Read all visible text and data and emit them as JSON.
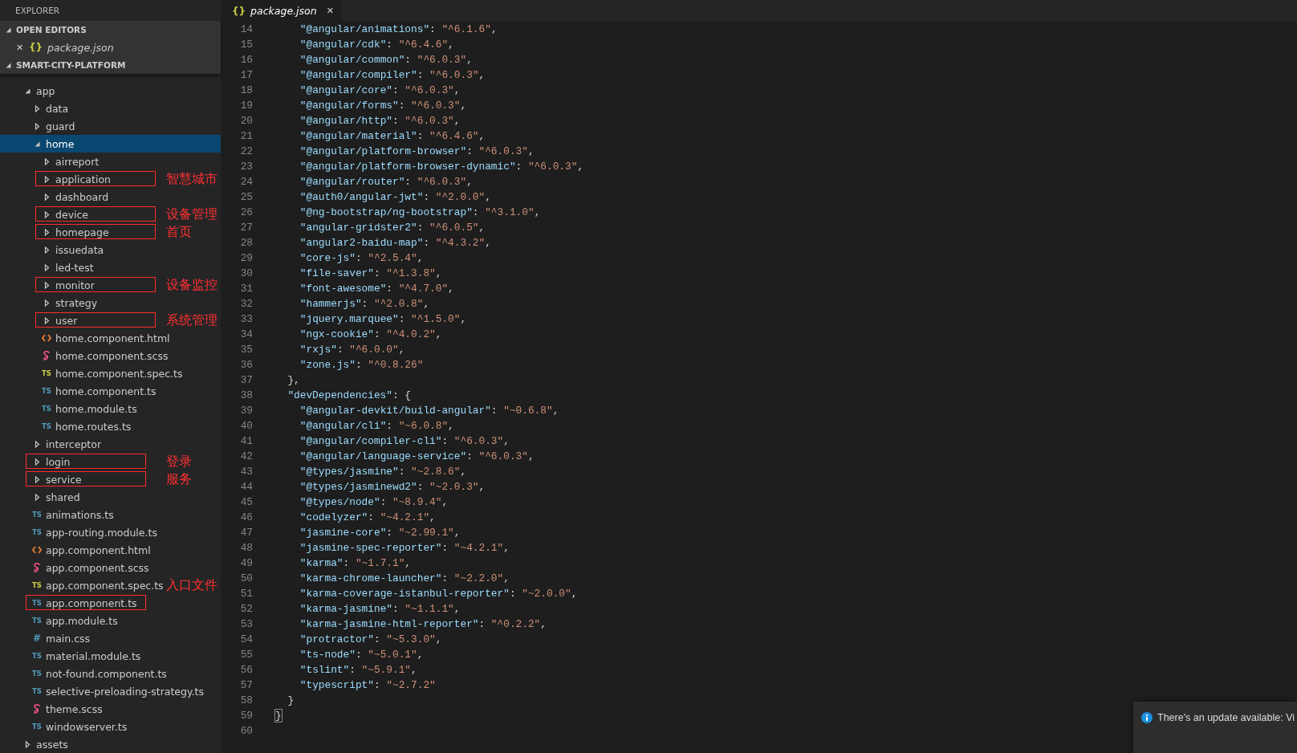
{
  "sidebar": {
    "title": "EXPLORER",
    "open_editors": {
      "label": "OPEN EDITORS",
      "expanded": true,
      "items": [
        {
          "close": "✕",
          "icon_text": "{}",
          "name": "package.json",
          "selected": false
        }
      ]
    },
    "project": {
      "label": "SMART-CITY-PLATFORM",
      "expanded": true
    },
    "tree": [
      {
        "name": "app",
        "kind": "folder",
        "expanded": true,
        "selected": false,
        "annotated": false,
        "children": [
          {
            "name": "data",
            "kind": "folder",
            "expanded": false,
            "selected": false,
            "annotated": false
          },
          {
            "name": "guard",
            "kind": "folder",
            "expanded": false,
            "selected": false,
            "annotated": false
          },
          {
            "name": "home",
            "kind": "folder",
            "expanded": true,
            "selected": true,
            "annotated": false,
            "children": [
              {
                "name": "airreport",
                "kind": "folder",
                "expanded": false,
                "selected": false,
                "annotated": false
              },
              {
                "name": "application",
                "kind": "folder",
                "expanded": false,
                "selected": false,
                "annotated": true,
                "note": "智慧城市"
              },
              {
                "name": "dashboard",
                "kind": "folder",
                "expanded": false,
                "selected": false,
                "annotated": false
              },
              {
                "name": "device",
                "kind": "folder",
                "expanded": false,
                "selected": false,
                "annotated": true,
                "note": "设备管理"
              },
              {
                "name": "homepage",
                "kind": "folder",
                "expanded": false,
                "selected": false,
                "annotated": true,
                "note": "首页"
              },
              {
                "name": "issuedata",
                "kind": "folder",
                "expanded": false,
                "selected": false,
                "annotated": false
              },
              {
                "name": "led-test",
                "kind": "folder",
                "expanded": false,
                "selected": false,
                "annotated": false
              },
              {
                "name": "monitor",
                "kind": "folder",
                "expanded": false,
                "selected": false,
                "annotated": true,
                "note": "设备监控"
              },
              {
                "name": "strategy",
                "kind": "folder",
                "expanded": false,
                "selected": false,
                "annotated": false
              },
              {
                "name": "user",
                "kind": "folder",
                "expanded": false,
                "selected": false,
                "annotated": true,
                "note": "系统管理"
              },
              {
                "name": "home.component.html",
                "kind": "html",
                "selected": false,
                "annotated": false
              },
              {
                "name": "home.component.scss",
                "kind": "scss",
                "selected": false,
                "annotated": false
              },
              {
                "name": "home.component.spec.ts",
                "kind": "spec",
                "badge": "TS",
                "selected": false,
                "annotated": false
              },
              {
                "name": "home.component.ts",
                "kind": "ts",
                "badge": "TS",
                "selected": false,
                "annotated": false
              },
              {
                "name": "home.module.ts",
                "kind": "ts",
                "badge": "TS",
                "selected": false,
                "annotated": false
              },
              {
                "name": "home.routes.ts",
                "kind": "ts",
                "badge": "TS",
                "selected": false,
                "annotated": false
              }
            ]
          },
          {
            "name": "interceptor",
            "kind": "folder",
            "expanded": false,
            "selected": false,
            "annotated": false
          },
          {
            "name": "login",
            "kind": "folder",
            "expanded": false,
            "selected": false,
            "annotated": true,
            "note": "登录"
          },
          {
            "name": "service",
            "kind": "folder",
            "expanded": false,
            "selected": false,
            "annotated": true,
            "note": "服务"
          },
          {
            "name": "shared",
            "kind": "folder",
            "expanded": false,
            "selected": false,
            "annotated": false
          },
          {
            "name": "animations.ts",
            "kind": "ts",
            "badge": "TS",
            "selected": false,
            "annotated": false
          },
          {
            "name": "app-routing.module.ts",
            "kind": "ts",
            "badge": "TS",
            "selected": false,
            "annotated": false
          },
          {
            "name": "app.component.html",
            "kind": "html",
            "selected": false,
            "annotated": false
          },
          {
            "name": "app.component.scss",
            "kind": "scss",
            "selected": false,
            "annotated": false
          },
          {
            "name": "app.component.spec.ts",
            "kind": "spec",
            "badge": "TS",
            "selected": false,
            "annotated": false,
            "note": "入口文件"
          },
          {
            "name": "app.component.ts",
            "kind": "ts",
            "badge": "TS",
            "selected": false,
            "annotated": true
          },
          {
            "name": "app.module.ts",
            "kind": "ts",
            "badge": "TS",
            "selected": false,
            "annotated": false
          },
          {
            "name": "main.css",
            "kind": "css",
            "badge": "#",
            "selected": false,
            "annotated": false
          },
          {
            "name": "material.module.ts",
            "kind": "ts",
            "badge": "TS",
            "selected": false,
            "annotated": false
          },
          {
            "name": "not-found.component.ts",
            "kind": "ts",
            "badge": "TS",
            "selected": false,
            "annotated": false
          },
          {
            "name": "selective-preloading-strategy.ts",
            "kind": "ts",
            "badge": "TS",
            "selected": false,
            "annotated": false
          },
          {
            "name": "theme.scss",
            "kind": "scss",
            "selected": false,
            "annotated": false
          },
          {
            "name": "windowserver.ts",
            "kind": "ts",
            "badge": "TS",
            "selected": false,
            "annotated": false
          }
        ]
      },
      {
        "name": "assets",
        "kind": "folder",
        "expanded": false,
        "selected": false,
        "annotated": false
      }
    ]
  },
  "tabs": [
    {
      "icon_text": "{}",
      "label": "package.json",
      "close": "✕",
      "selected": true
    }
  ],
  "editor": {
    "lines": [
      {
        "number": "14",
        "kind": "entry",
        "key": "\"@angular/animations\"",
        "sep": ": ",
        "value": "\"^6.1.6\"",
        "end": ","
      },
      {
        "number": "15",
        "kind": "entry",
        "key": "\"@angular/cdk\"",
        "sep": ": ",
        "value": "\"^6.4.6\"",
        "end": ","
      },
      {
        "number": "16",
        "kind": "entry",
        "key": "\"@angular/common\"",
        "sep": ": ",
        "value": "\"^6.0.3\"",
        "end": ","
      },
      {
        "number": "17",
        "kind": "entry",
        "key": "\"@angular/compiler\"",
        "sep": ": ",
        "value": "\"^6.0.3\"",
        "end": ","
      },
      {
        "number": "18",
        "kind": "entry",
        "key": "\"@angular/core\"",
        "sep": ": ",
        "value": "\"^6.0.3\"",
        "end": ","
      },
      {
        "number": "19",
        "kind": "entry",
        "key": "\"@angular/forms\"",
        "sep": ": ",
        "value": "\"^6.0.3\"",
        "end": ","
      },
      {
        "number": "20",
        "kind": "entry",
        "key": "\"@angular/http\"",
        "sep": ": ",
        "value": "\"^6.0.3\"",
        "end": ","
      },
      {
        "number": "21",
        "kind": "entry",
        "key": "\"@angular/material\"",
        "sep": ": ",
        "value": "\"^6.4.6\"",
        "end": ","
      },
      {
        "number": "22",
        "kind": "entry",
        "key": "\"@angular/platform-browser\"",
        "sep": ": ",
        "value": "\"^6.0.3\"",
        "end": ","
      },
      {
        "number": "23",
        "kind": "entry",
        "key": "\"@angular/platform-browser-dynamic\"",
        "sep": ": ",
        "value": "\"^6.0.3\"",
        "end": ","
      },
      {
        "number": "24",
        "kind": "entry",
        "key": "\"@angular/router\"",
        "sep": ": ",
        "value": "\"^6.0.3\"",
        "end": ","
      },
      {
        "number": "25",
        "kind": "entry",
        "key": "\"@auth0/angular-jwt\"",
        "sep": ": ",
        "value": "\"^2.0.0\"",
        "end": ","
      },
      {
        "number": "26",
        "kind": "entry",
        "key": "\"@ng-bootstrap/ng-bootstrap\"",
        "sep": ": ",
        "value": "\"^3.1.0\"",
        "end": ","
      },
      {
        "number": "27",
        "kind": "entry",
        "key": "\"angular-gridster2\"",
        "sep": ": ",
        "value": "\"^6.0.5\"",
        "end": ","
      },
      {
        "number": "28",
        "kind": "entry",
        "key": "\"angular2-baidu-map\"",
        "sep": ": ",
        "value": "\"^4.3.2\"",
        "end": ","
      },
      {
        "number": "29",
        "kind": "entry",
        "key": "\"core-js\"",
        "sep": ": ",
        "value": "\"^2.5.4\"",
        "end": ","
      },
      {
        "number": "30",
        "kind": "entry",
        "key": "\"file-saver\"",
        "sep": ": ",
        "value": "\"^1.3.8\"",
        "end": ","
      },
      {
        "number": "31",
        "kind": "entry",
        "key": "\"font-awesome\"",
        "sep": ": ",
        "value": "\"^4.7.0\"",
        "end": ","
      },
      {
        "number": "32",
        "kind": "entry",
        "key": "\"hammerjs\"",
        "sep": ": ",
        "value": "\"^2.0.8\"",
        "end": ","
      },
      {
        "number": "33",
        "kind": "entry",
        "key": "\"jquery.marquee\"",
        "sep": ": ",
        "value": "\"^1.5.0\"",
        "end": ","
      },
      {
        "number": "34",
        "kind": "entry",
        "key": "\"ngx-cookie\"",
        "sep": ": ",
        "value": "\"^4.0.2\"",
        "end": ","
      },
      {
        "number": "35",
        "kind": "entry",
        "key": "\"rxjs\"",
        "sep": ": ",
        "value": "\"^6.0.0\"",
        "end": ","
      },
      {
        "number": "36",
        "kind": "entry",
        "key": "\"zone.js\"",
        "sep": ": ",
        "value": "\"^0.8.26\""
      },
      {
        "number": "37",
        "kind": "section",
        "end": "},"
      },
      {
        "number": "38",
        "kind": "section",
        "key": "\"devDependencies\"",
        "end": ": {"
      },
      {
        "number": "39",
        "kind": "entry",
        "key": "\"@angular-devkit/build-angular\"",
        "sep": ": ",
        "value": "\"~0.6.8\"",
        "end": ","
      },
      {
        "number": "40",
        "kind": "entry",
        "key": "\"@angular/cli\"",
        "sep": ": ",
        "value": "\"~6.0.8\"",
        "end": ","
      },
      {
        "number": "41",
        "kind": "entry",
        "key": "\"@angular/compiler-cli\"",
        "sep": ": ",
        "value": "\"^6.0.3\"",
        "end": ","
      },
      {
        "number": "42",
        "kind": "entry",
        "key": "\"@angular/language-service\"",
        "sep": ": ",
        "value": "\"^6.0.3\"",
        "end": ","
      },
      {
        "number": "43",
        "kind": "entry",
        "key": "\"@types/jasmine\"",
        "sep": ": ",
        "value": "\"~2.8.6\"",
        "end": ","
      },
      {
        "number": "44",
        "kind": "entry",
        "key": "\"@types/jasminewd2\"",
        "sep": ": ",
        "value": "\"~2.0.3\"",
        "end": ","
      },
      {
        "number": "45",
        "kind": "entry",
        "key": "\"@types/node\"",
        "sep": ": ",
        "value": "\"~8.9.4\"",
        "end": ","
      },
      {
        "number": "46",
        "kind": "entry",
        "key": "\"codelyzer\"",
        "sep": ": ",
        "value": "\"~4.2.1\"",
        "end": ","
      },
      {
        "number": "47",
        "kind": "entry",
        "key": "\"jasmine-core\"",
        "sep": ": ",
        "value": "\"~2.99.1\"",
        "end": ","
      },
      {
        "number": "48",
        "kind": "entry",
        "key": "\"jasmine-spec-reporter\"",
        "sep": ": ",
        "value": "\"~4.2.1\"",
        "end": ","
      },
      {
        "number": "49",
        "kind": "entry",
        "key": "\"karma\"",
        "sep": ": ",
        "value": "\"~1.7.1\"",
        "end": ","
      },
      {
        "number": "50",
        "kind": "entry",
        "key": "\"karma-chrome-launcher\"",
        "sep": ": ",
        "value": "\"~2.2.0\"",
        "end": ","
      },
      {
        "number": "51",
        "kind": "entry",
        "key": "\"karma-coverage-istanbul-reporter\"",
        "sep": ": ",
        "value": "\"~2.0.0\"",
        "end": ","
      },
      {
        "number": "52",
        "kind": "entry",
        "key": "\"karma-jasmine\"",
        "sep": ": ",
        "value": "\"~1.1.1\"",
        "end": ","
      },
      {
        "number": "53",
        "kind": "entry",
        "key": "\"karma-jasmine-html-reporter\"",
        "sep": ": ",
        "value": "\"^0.2.2\"",
        "end": ","
      },
      {
        "number": "54",
        "kind": "entry",
        "key": "\"protractor\"",
        "sep": ": ",
        "value": "\"~5.3.0\"",
        "end": ","
      },
      {
        "number": "55",
        "kind": "entry",
        "key": "\"ts-node\"",
        "sep": ": ",
        "value": "\"~5.0.1\"",
        "end": ","
      },
      {
        "number": "56",
        "kind": "entry",
        "key": "\"tslint\"",
        "sep": ": ",
        "value": "\"~5.9.1\"",
        "end": ","
      },
      {
        "number": "57",
        "kind": "entry",
        "key": "\"typescript\"",
        "sep": ": ",
        "value": "\"~2.7.2\""
      },
      {
        "number": "58",
        "kind": "section",
        "end": "}"
      },
      {
        "number": "59",
        "kind": "root",
        "bracket": "}"
      },
      {
        "number": "60",
        "kind": "blank"
      }
    ]
  },
  "notification": {
    "text": "There's an update available: Vi"
  }
}
